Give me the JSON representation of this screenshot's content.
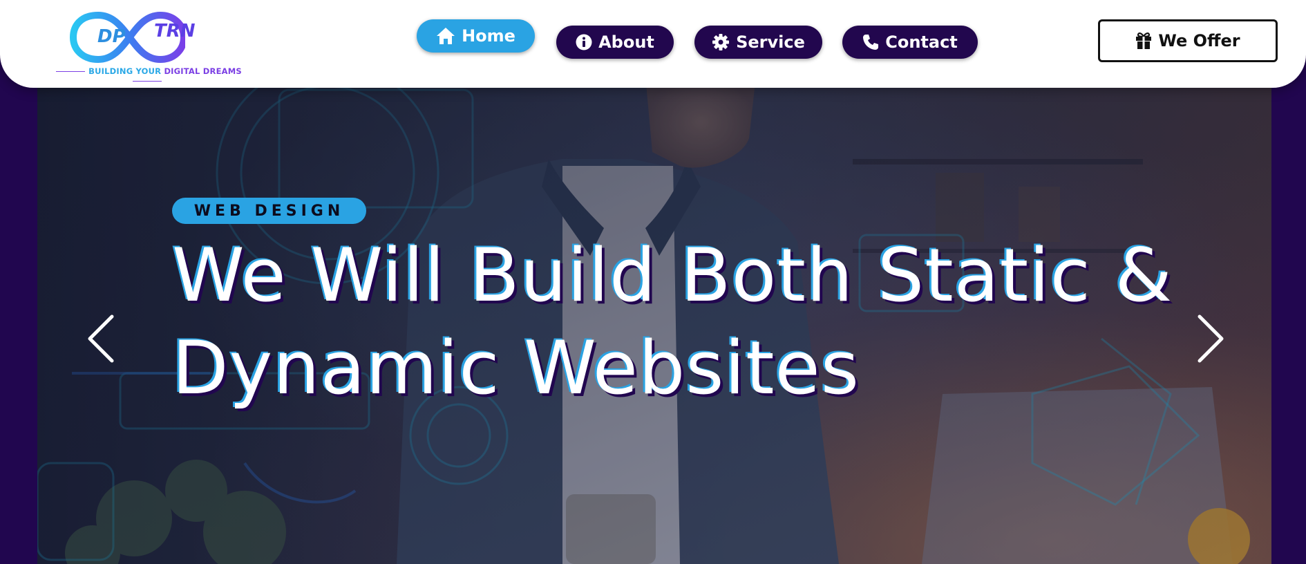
{
  "brand": {
    "logo_dp": "DP",
    "logo_trn": "TRN",
    "tagline_part1": "BUILDING YOUR ",
    "tagline_part2": "DIGITAL DREAMS"
  },
  "nav": {
    "home": "Home",
    "about": "About",
    "service": "Service",
    "contact": "Contact",
    "offer": "We Offer"
  },
  "hero": {
    "badge": "WEB DESIGN",
    "headline_line1": "We Will Build Both Static &",
    "headline_line2": "Dynamic Websites"
  },
  "colors": {
    "accent": "#2aa3e3",
    "navy": "#21064f",
    "white": "#ffffff"
  }
}
